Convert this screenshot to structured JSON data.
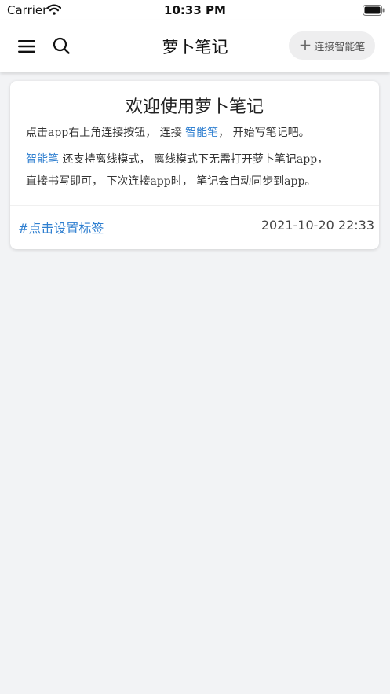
{
  "status_bar": {
    "carrier": "Carrier",
    "time": "10:33 PM"
  },
  "nav": {
    "title": "萝卜笔记",
    "connect_label": "连接智能笔",
    "icons": [
      "menu-icon",
      "search-icon",
      "plus-icon"
    ]
  },
  "note": {
    "title": "欢迎使用萝卜笔记",
    "line1_a": "点击app右上角连接按钮，  连接 ",
    "line1_pen": "智能笔",
    "line1_b": "，  开始写笔记吧。",
    "line2_pen": "智能笔",
    "line2_a": " 还支持离线模式，  离线模式下无需打开萝卜笔记app，",
    "line3": "直接书写即可，  下次连接app时，  笔记会自动同步到app。",
    "tag": "#点击设置标签",
    "date": "2021-10-20 22:33"
  },
  "colors": {
    "accent": "#2f7fd0",
    "background": "#f2f3f5",
    "card": "#ffffff"
  }
}
